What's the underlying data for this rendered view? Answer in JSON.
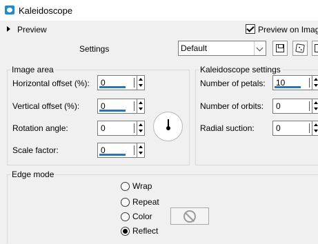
{
  "window": {
    "title": "Kaleidoscope"
  },
  "preview": {
    "label": "Preview",
    "checkbox_label": "Preview on Image",
    "checked": true
  },
  "settings": {
    "label": "Settings",
    "preset": "Default"
  },
  "image_area": {
    "title": "Image area",
    "fields": [
      {
        "label": "Horizontal offset (%):",
        "value": "0"
      },
      {
        "label": "Vertical offset (%):",
        "value": "0"
      },
      {
        "label": "Rotation angle:",
        "value": "0"
      },
      {
        "label": "Scale factor:",
        "value": "0"
      }
    ]
  },
  "kaleidoscope": {
    "title": "Kaleidoscope settings",
    "fields": [
      {
        "label": "Number of petals:",
        "value": "10"
      },
      {
        "label": "Number of orbits:",
        "value": "0"
      },
      {
        "label": "Radial suction:",
        "value": "0"
      }
    ]
  },
  "edge_mode": {
    "title": "Edge mode",
    "options": [
      {
        "label": "Wrap",
        "selected": false
      },
      {
        "label": "Repeat",
        "selected": false
      },
      {
        "label": "Color",
        "selected": false
      },
      {
        "label": "Reflect",
        "selected": true
      }
    ]
  },
  "icons": {
    "app": "kaleidoscope-app-icon",
    "save": "floppy-disk-icon",
    "random": "dice-icon",
    "reset": "reset-icon",
    "rotation": "rotation-dial-icon",
    "no_color": "no-sign-icon"
  },
  "colors": {
    "accent": "#1e74d1",
    "app_icon": "#1a8bd6"
  }
}
